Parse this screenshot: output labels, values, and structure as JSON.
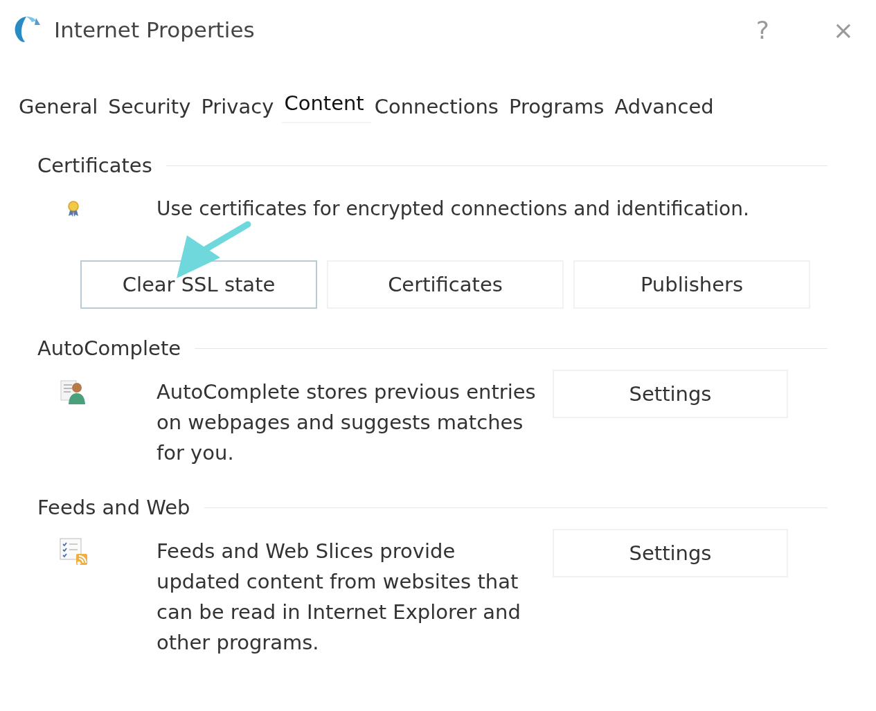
{
  "window": {
    "title": "Internet Properties",
    "controls": [
      "?",
      "×"
    ]
  },
  "tabs": [
    {
      "label": "General",
      "selected": false
    },
    {
      "label": "Security",
      "selected": false
    },
    {
      "label": "Privacy",
      "selected": false
    },
    {
      "label": "Content",
      "selected": true
    },
    {
      "label": "Connections",
      "selected": false
    },
    {
      "label": "Programs",
      "selected": false
    },
    {
      "label": "Advanced",
      "selected": false
    }
  ],
  "sections": [
    {
      "title": "Certificates",
      "description": "Use certificates for encrypted connections and identification.",
      "buttons": [
        {
          "label": "Clear SSL state",
          "focused": true
        },
        {
          "label": "Certificates",
          "focused": false
        },
        {
          "label": "Publishers",
          "focused": false
        }
      ]
    },
    {
      "title": "AutoComplete",
      "description": "AutoComplete stores previous entries on webpages and suggests matches for you.",
      "side_button": "Settings"
    },
    {
      "title": "Feeds and Web",
      "description": "Feeds and Web Slices provide updated content from websites that can be read in Internet Explorer and other programs.",
      "side_button": "Settings"
    }
  ],
  "annotation": {
    "kind": "arrow"
  }
}
